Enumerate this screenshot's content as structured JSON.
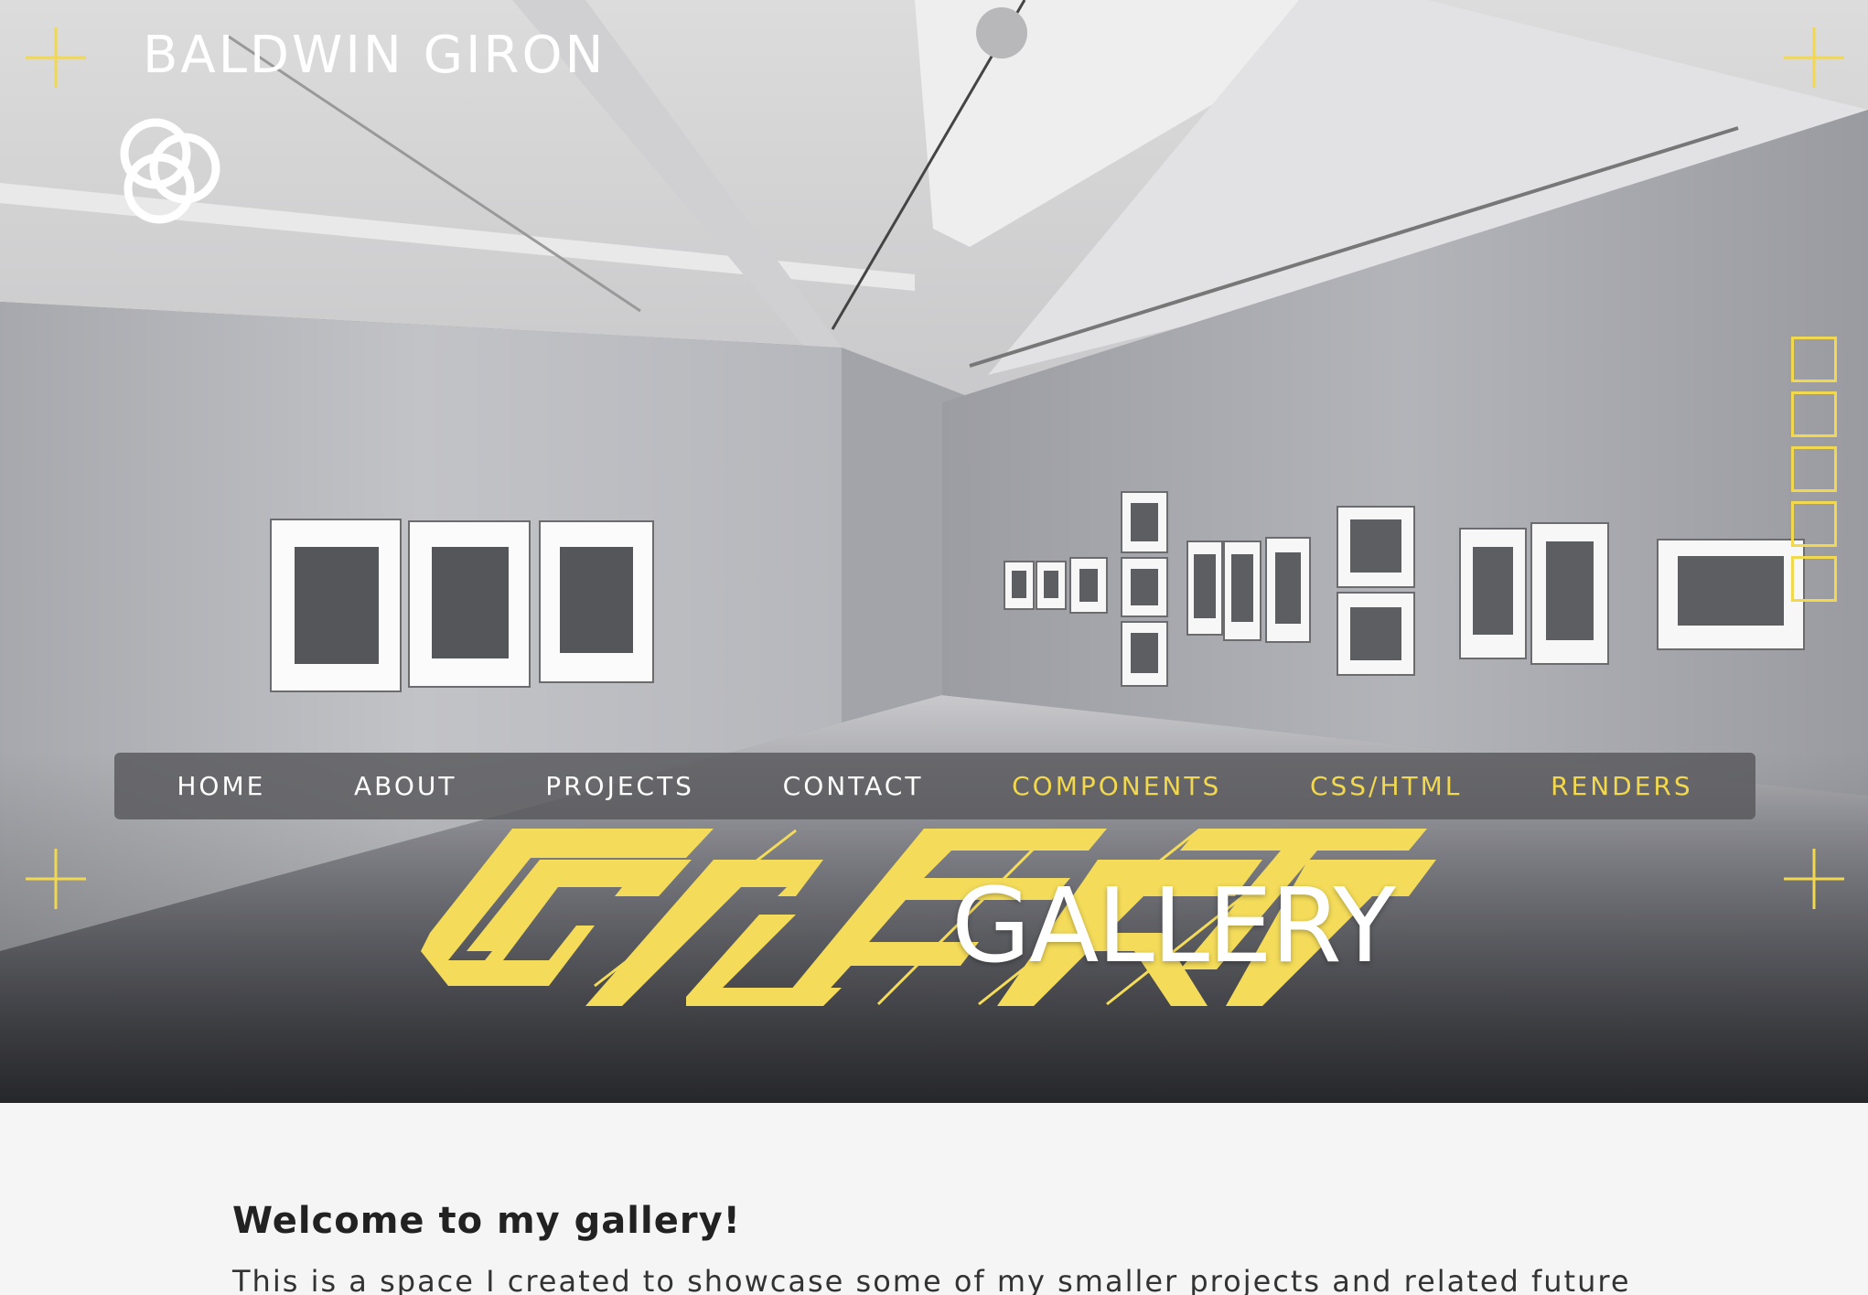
{
  "brand": {
    "name": "BALDWIN GIRON",
    "logo_icon": "interlocking-rings-icon"
  },
  "nav": {
    "items": [
      {
        "label": "HOME",
        "accent": false
      },
      {
        "label": "ABOUT",
        "accent": false
      },
      {
        "label": "PROJECTS",
        "accent": false
      },
      {
        "label": "CONTACT",
        "accent": false
      },
      {
        "label": "COMPONENTS",
        "accent": true
      },
      {
        "label": "CSS/HTML",
        "accent": true
      },
      {
        "label": "RENDERS",
        "accent": true
      }
    ]
  },
  "hero": {
    "title": "GALLERY",
    "background": "photo of a white-walled art gallery with framed black-and-white photographs"
  },
  "side_nav": {
    "count": 5
  },
  "content": {
    "heading": "Welcome to my gallery!",
    "intro": "This is a space I created to showcase some of my smaller projects and related future"
  },
  "colors": {
    "accent": "#f2d84f",
    "nav_background": "#5a5a5e",
    "content_background": "#f5f5f5",
    "text_dark": "#222222"
  }
}
